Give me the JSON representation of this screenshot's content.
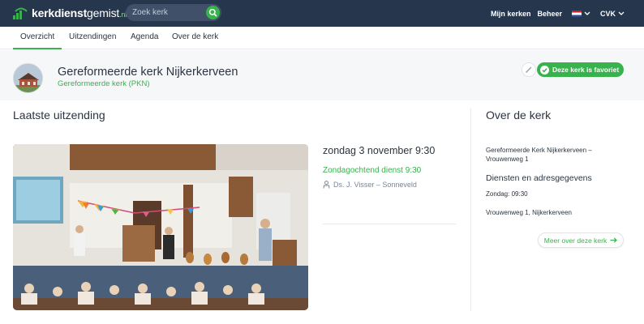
{
  "colors": {
    "topbar": "#26374d",
    "accent": "#37b24d",
    "text": "#2b3440",
    "muted": "#7a8594"
  },
  "brand": {
    "name_bold": "kerkdienst",
    "name_light": "gemist",
    "tld": ".nl",
    "icon": "signal-icon"
  },
  "search": {
    "placeholder": "Zoek kerk",
    "icon": "search-icon"
  },
  "topnav": {
    "my_churches": "Mijn kerken",
    "manage": "Beheer",
    "language_flag": "nl-flag-icon",
    "user": "CVK"
  },
  "tabs": [
    {
      "label": "Overzicht",
      "active": true
    },
    {
      "label": "Uitzendingen",
      "active": false
    },
    {
      "label": "Agenda",
      "active": false
    },
    {
      "label": "Over de kerk",
      "active": false
    }
  ],
  "church": {
    "name": "Gereformeerde kerk Nijkerkerveen",
    "denomination": "Gereformeerde kerk (PKN)",
    "favorite_label": "Deze kerk is favoriet"
  },
  "latest": {
    "heading": "Laatste uitzending",
    "date": "zondag 3 november 9:30",
    "title": "Zondagochtend dienst 9:30",
    "preacher": "Ds. J. Visser – Sonneveld"
  },
  "about": {
    "heading": "Over de kerk",
    "name_address": "Gereformeerde Kerk Nijkerkerveen – Vrouwenweg 1",
    "services_heading": "Diensten en adresgegevens",
    "service_time": "Zondag: 09:30",
    "address": "Vrouwenweg 1, Nijkerkerveen",
    "more_label": "Meer over deze kerk"
  }
}
